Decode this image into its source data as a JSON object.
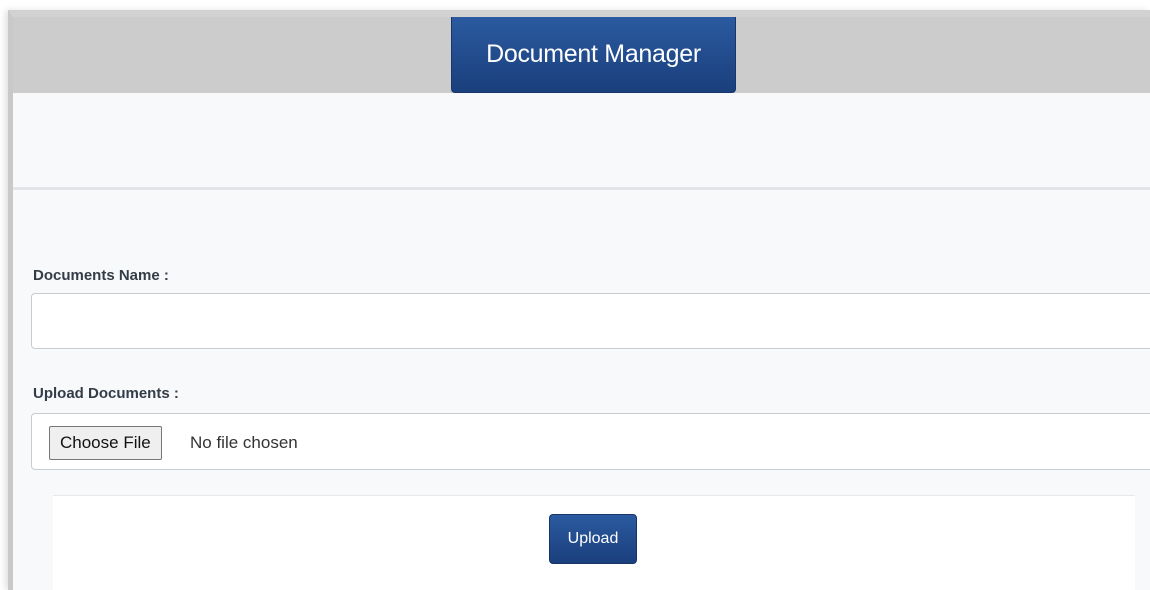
{
  "header": {
    "title": "Document Manager"
  },
  "form": {
    "name_label": "Documents Name :",
    "name_value": "",
    "name_placeholder": "",
    "upload_label": "Upload Documents :",
    "choose_file_label": "Choose File",
    "file_status": "No file chosen",
    "submit_label": "Upload"
  },
  "colors": {
    "header_bar": "#cccccc",
    "accent": "#1f4a8c",
    "page_background": "#f8f9fb"
  }
}
